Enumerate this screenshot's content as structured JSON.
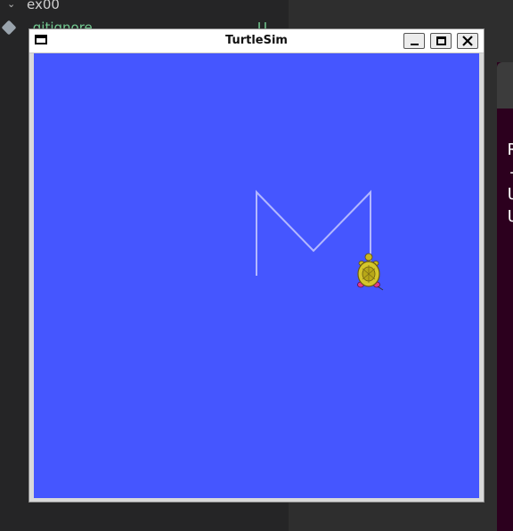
{
  "background_editor": {
    "folder_label": "ex00",
    "file_label": ".gitignore",
    "file_status": "U"
  },
  "window": {
    "title": "TurtleSim",
    "background_color": "#4556ff",
    "pen_color": "#b3b8ff",
    "turtle_color": "#d4c62b"
  },
  "terminal": {
    "lines": [
      "R",
      "-",
      "U",
      "U"
    ]
  }
}
